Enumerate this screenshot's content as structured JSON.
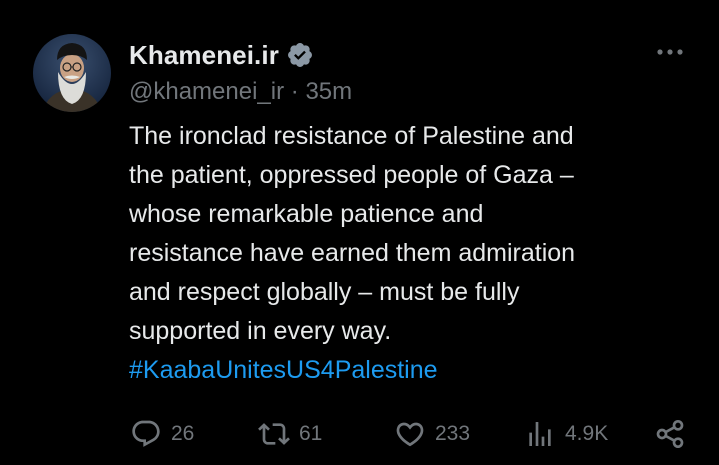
{
  "author": {
    "display_name": "Khamenei.ir",
    "handle": "@khamenei_ir",
    "separator": "·",
    "time_ago": "35m",
    "verified_icon": "verified-badge-icon"
  },
  "tweet": {
    "text": "The ironclad resistance of Palestine and\nthe patient, oppressed people of Gaza –\nwhose remarkable patience and\nresistance have earned them admiration\nand respect globally – must be fully\nsupported in every way.",
    "hashtag": "#KaabaUnitesUS4Palestine"
  },
  "actions": {
    "reply_count": "26",
    "repost_count": "61",
    "like_count": "233",
    "views_count": "4.9K"
  },
  "icons": {
    "more": "more-horizontal-icon",
    "reply": "reply-icon",
    "repost": "repost-icon",
    "like": "heart-icon",
    "views": "views-icon",
    "share": "share-icon"
  },
  "colors": {
    "background": "#000000",
    "text_primary": "#e7e9ea",
    "text_secondary": "#71767b",
    "link": "#1d9bf0"
  }
}
